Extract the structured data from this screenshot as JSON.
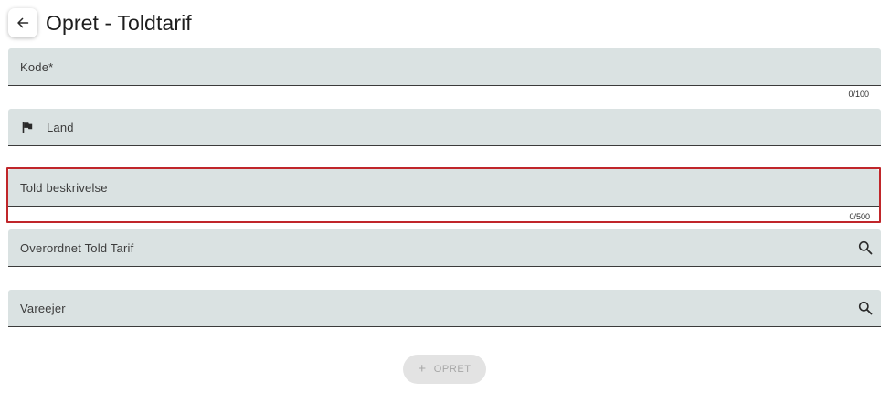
{
  "header": {
    "title": "Opret - Toldtarif"
  },
  "form": {
    "kode": {
      "label": "Kode*",
      "counter": "0/100"
    },
    "land": {
      "label": "Land",
      "icon": "flag-icon"
    },
    "beskrivelse": {
      "label": "Told beskrivelse",
      "counter": "0/500",
      "state": "error",
      "error_color": "#c0262a"
    },
    "overordnet": {
      "label": "Overordnet Told Tarif",
      "icon": "search-icon"
    },
    "vareejer": {
      "label": "Vareejer",
      "icon": "search-icon"
    }
  },
  "actions": {
    "submit_label": "OPRET",
    "submit_icon": "plus-icon",
    "submit_disabled": true
  },
  "colors": {
    "field_background": "#dae2e2",
    "error_border": "#c0262a",
    "button_disabled_background": "#e3e3e3"
  }
}
